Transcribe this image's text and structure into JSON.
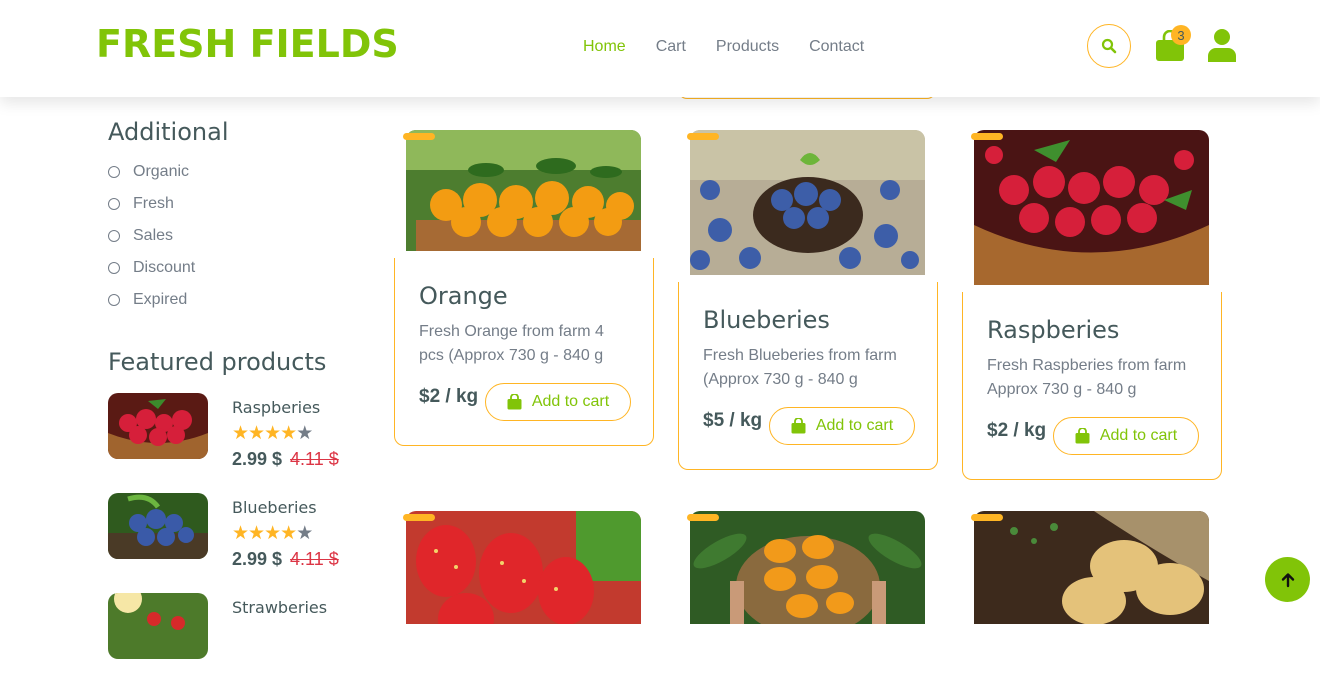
{
  "header": {
    "logo": "FRESH FIELDS",
    "nav": [
      "Home",
      "Cart",
      "Products",
      "Contact"
    ],
    "cart_count": "3"
  },
  "sidebar": {
    "additional_title": "Additional",
    "options": [
      "Organic",
      "Fresh",
      "Sales",
      "Discount",
      "Expired"
    ],
    "featured_title": "Featured products",
    "featured": [
      {
        "name": "Raspberies",
        "rating": 4,
        "price": "2.99 $",
        "old_price": "4.11 $"
      },
      {
        "name": "Blueberies",
        "rating": 4,
        "price": "2.99 $",
        "old_price": "4.11 $"
      },
      {
        "name": "Strawberies"
      }
    ]
  },
  "products": [
    {
      "title": "Orange",
      "desc": "Fresh Orange from farm 4 pcs (Approx 730 g - 840 g",
      "price": "$2 / kg",
      "button": "Add to cart"
    },
    {
      "title": "Blueberies",
      "desc": "Fresh Blueberies from farm (Approx 730 g - 840 g",
      "price": "$5 / kg",
      "button": "Add to cart"
    },
    {
      "title": "Raspberies",
      "desc": "Fresh Raspberies from farm Approx 730 g - 840 g",
      "price": "$2 / kg",
      "button": "Add to cart"
    }
  ],
  "colors": {
    "primary": "#81c408",
    "accent": "#ffb524",
    "text": "#45595b",
    "muted": "#747d88",
    "sale": "#dc3545"
  },
  "icons": [
    "search-icon",
    "shopping-bag-icon",
    "user-icon",
    "star-icon",
    "arrow-up-icon"
  ]
}
